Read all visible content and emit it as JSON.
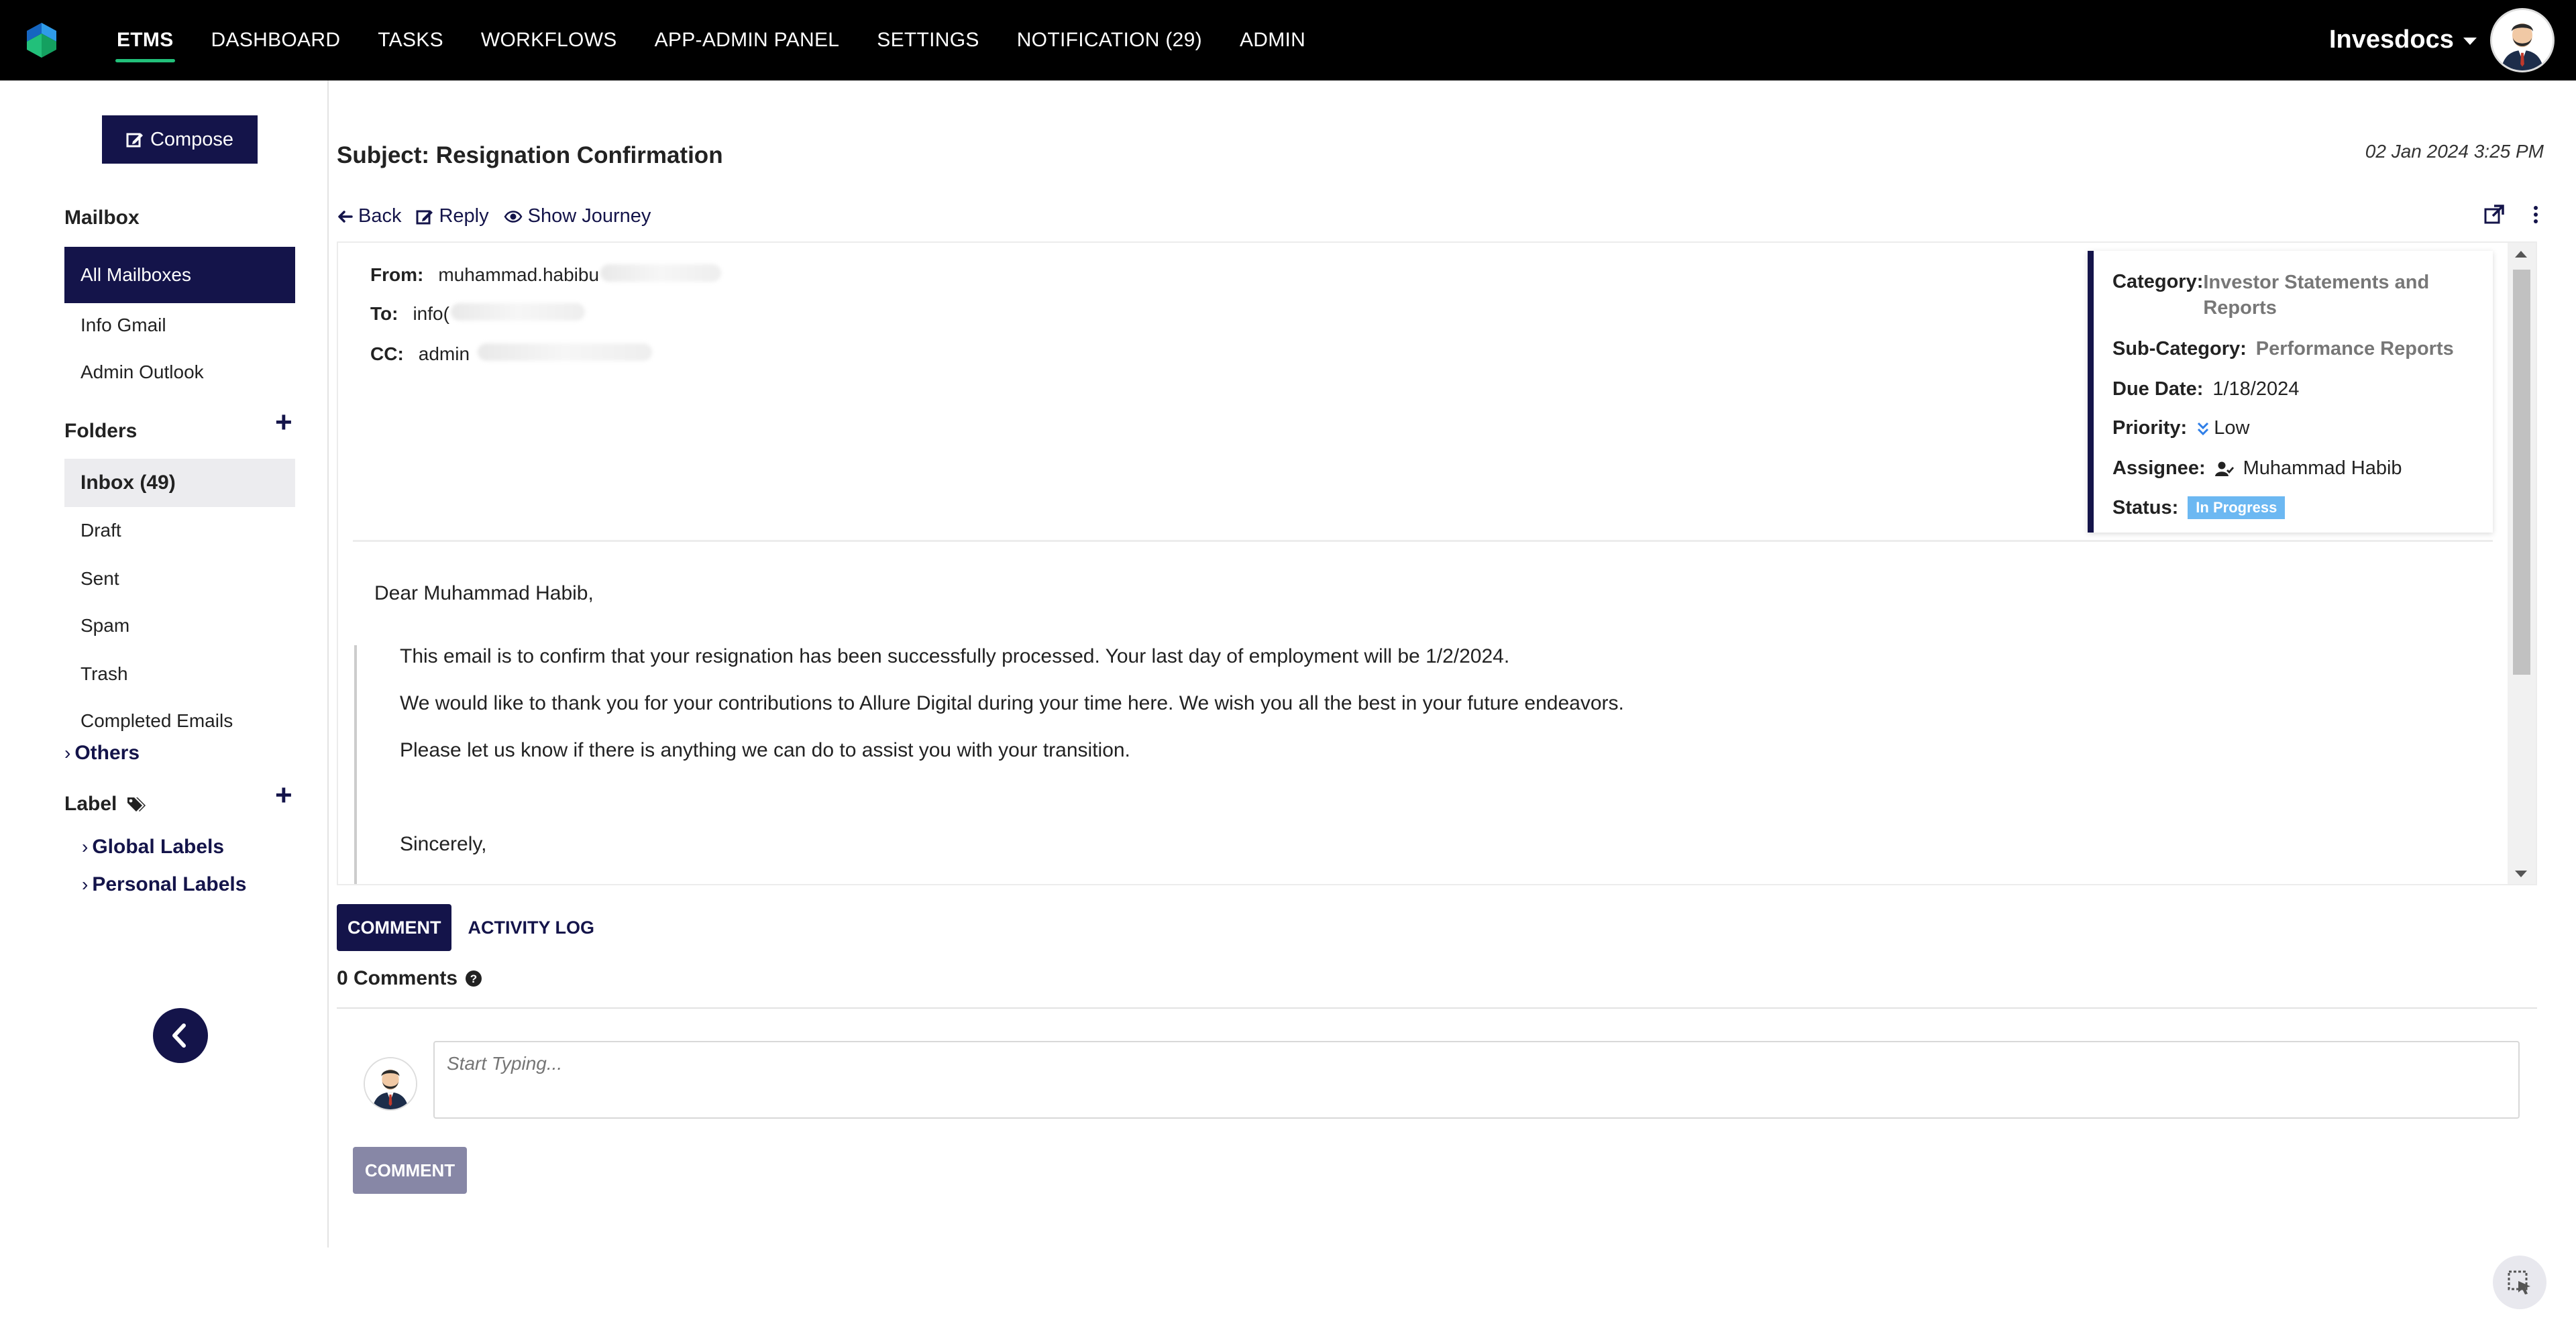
{
  "topnav": {
    "items": [
      "ETMS",
      "DASHBOARD",
      "TASKS",
      "WORKFLOWS",
      "APP-ADMIN PANEL",
      "SETTINGS",
      "NOTIFICATION (29)",
      "ADMIN"
    ],
    "active": "ETMS",
    "brand": "Invesdocs"
  },
  "sidebar": {
    "compose_label": "Compose",
    "mailbox_heading": "Mailbox",
    "mailboxes": [
      "All Mailboxes",
      "Info Gmail",
      "Admin Outlook"
    ],
    "folders_heading": "Folders",
    "folders": [
      "Inbox (49)",
      "Draft",
      "Sent",
      "Spam",
      "Trash",
      "Completed Emails"
    ],
    "others_label": "Others",
    "label_heading": "Label",
    "labels": [
      "Global Labels",
      "Personal Labels"
    ]
  },
  "email": {
    "subject": "Subject: Resignation Confirmation",
    "datetime": "02 Jan 2024 3:25 PM",
    "actions": {
      "back": "Back",
      "reply": "Reply",
      "journey": "Show Journey"
    },
    "from_label": "From:",
    "from_value": "muhammad.habibu",
    "to_label": "To:",
    "to_value": "info(",
    "cc_label": "CC:",
    "cc_value": "admin",
    "greeting": "Dear Muhammad Habib,",
    "body": [
      "This email is to confirm that your resignation has been successfully processed. Your last day of employment will be 1/2/2024.",
      "We would like to thank you for your contributions to Allure Digital during your time here. We wish you all the best in your future endeavors.",
      "Please let us know if there is anything we can do to assist you with your transition.",
      "Sincerely,"
    ]
  },
  "details": {
    "category_label": "Category:",
    "category_value_1": "Investor Statements and",
    "category_value_2": "Reports",
    "subcategory_label": "Sub-Category:",
    "subcategory_value": "Performance Reports",
    "duedate_label": "Due Date:",
    "duedate_value": "1/18/2024",
    "priority_label": "Priority:",
    "priority_value": "Low",
    "assignee_label": "Assignee:",
    "assignee_value": "Muhammad Habib",
    "status_label": "Status:",
    "status_value": "In Progress",
    "status_color": "#6cb8f2"
  },
  "comments": {
    "tabs": [
      "COMMENT",
      "ACTIVITY LOG"
    ],
    "count_label": "0 Comments",
    "placeholder": "Start Typing...",
    "submit": "COMMENT"
  },
  "colors": {
    "primary": "#14144a",
    "accent": "#22c07a"
  }
}
